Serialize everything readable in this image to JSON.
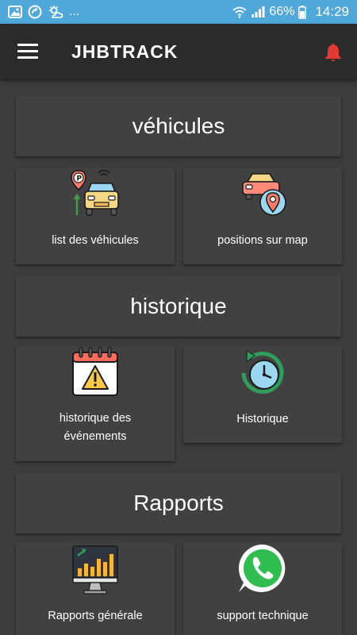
{
  "status_bar": {
    "ellipsis": "...",
    "battery": "66%",
    "time": "14:29"
  },
  "app_bar": {
    "title": "JHBTRACK"
  },
  "sections": [
    {
      "title": "véhicules",
      "cards": [
        {
          "label": "list des véhicules",
          "icon": "parked-car-icon"
        },
        {
          "label": "positions sur map",
          "icon": "car-location-pin-icon"
        }
      ]
    },
    {
      "title": "historique",
      "cards": [
        {
          "label_lines": [
            "historique des",
            "événements"
          ],
          "icon": "calendar-warning-icon"
        },
        {
          "label": "Historique",
          "icon": "clock-history-icon"
        }
      ]
    },
    {
      "title": "Rapports",
      "cards": [
        {
          "label": "Rapports générale",
          "icon": "bar-chart-monitor-icon"
        },
        {
          "label": "support technique",
          "icon": "whatsapp-icon"
        }
      ]
    }
  ],
  "colors": {
    "status_bar": "#4fa7da",
    "app_bar": "#2b2b2b",
    "background": "#3c3c3c",
    "card": "#414141",
    "bell": "#e53935"
  }
}
